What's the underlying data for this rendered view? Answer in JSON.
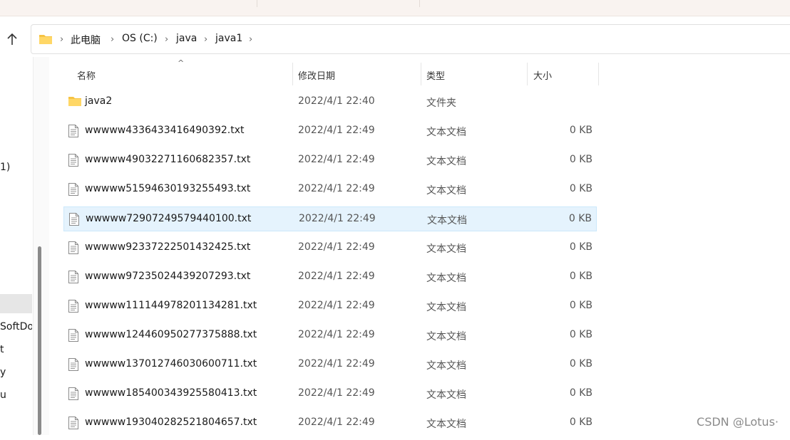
{
  "window": {
    "up_icon": "arrow-up-icon"
  },
  "address_bar": {
    "folder_icon": "folder-icon",
    "crumbs": [
      "此电脑",
      "OS (C:)",
      "java",
      "java1"
    ]
  },
  "nav_pane": {
    "items": [
      "1)",
      "SoftDo",
      "t",
      "y",
      "u"
    ]
  },
  "columns": {
    "name": "名称",
    "date": "修改日期",
    "type": "类型",
    "size": "大小",
    "sort_indicator": "^"
  },
  "files": [
    {
      "name": "java2",
      "date": "2022/4/1 22:40",
      "type": "文件夹",
      "size": "",
      "icon": "folder-icon"
    },
    {
      "name": "wwwww4336433416490392.txt",
      "date": "2022/4/1 22:49",
      "type": "文本文档",
      "size": "0 KB",
      "icon": "text-file-icon"
    },
    {
      "name": "wwwww49032271160682357.txt",
      "date": "2022/4/1 22:49",
      "type": "文本文档",
      "size": "0 KB",
      "icon": "text-file-icon"
    },
    {
      "name": "wwwww51594630193255493.txt",
      "date": "2022/4/1 22:49",
      "type": "文本文档",
      "size": "0 KB",
      "icon": "text-file-icon"
    },
    {
      "name": "wwwww72907249579440100.txt",
      "date": "2022/4/1 22:49",
      "type": "文本文档",
      "size": "0 KB",
      "icon": "text-file-icon",
      "selected": true
    },
    {
      "name": "wwwww92337222501432425.txt",
      "date": "2022/4/1 22:49",
      "type": "文本文档",
      "size": "0 KB",
      "icon": "text-file-icon"
    },
    {
      "name": "wwwww97235024439207293.txt",
      "date": "2022/4/1 22:49",
      "type": "文本文档",
      "size": "0 KB",
      "icon": "text-file-icon"
    },
    {
      "name": "wwwww111144978201134281.txt",
      "date": "2022/4/1 22:49",
      "type": "文本文档",
      "size": "0 KB",
      "icon": "text-file-icon"
    },
    {
      "name": "wwwww124460950277375888.txt",
      "date": "2022/4/1 22:49",
      "type": "文本文档",
      "size": "0 KB",
      "icon": "text-file-icon"
    },
    {
      "name": "wwwww137012746030600711.txt",
      "date": "2022/4/1 22:49",
      "type": "文本文档",
      "size": "0 KB",
      "icon": "text-file-icon"
    },
    {
      "name": "wwwww185400343925580413.txt",
      "date": "2022/4/1 22:49",
      "type": "文本文档",
      "size": "0 KB",
      "icon": "text-file-icon"
    },
    {
      "name": "wwwww193040282521804657.txt",
      "date": "2022/4/1 22:49",
      "type": "文本文档",
      "size": "0 KB",
      "icon": "text-file-icon"
    }
  ],
  "watermark": "CSDN @Lotus·",
  "colors": {
    "selection_bg": "#e5f3fd",
    "folder": "#f6c343"
  }
}
